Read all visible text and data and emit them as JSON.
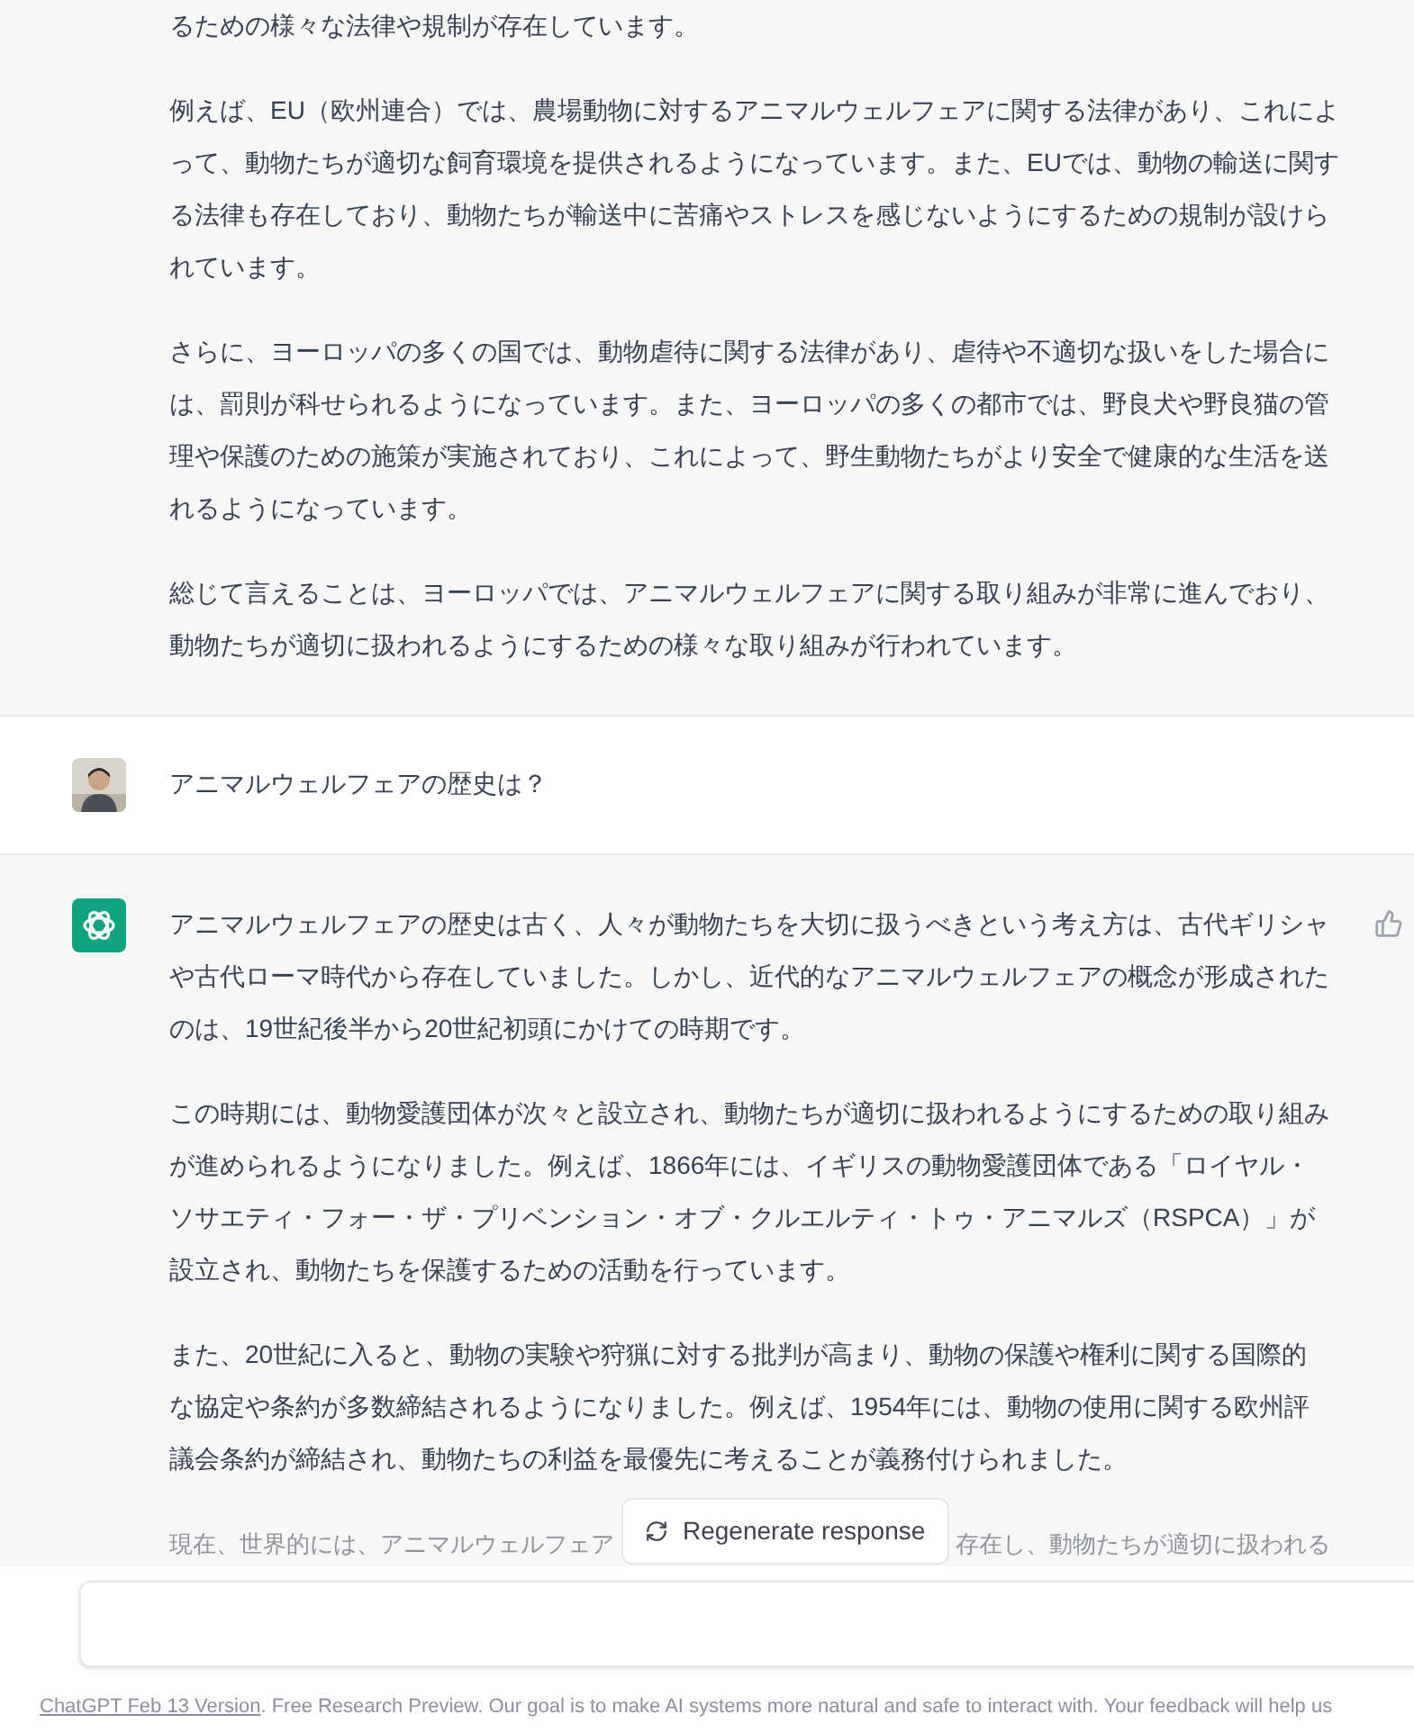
{
  "messages": [
    {
      "kind": "assistant",
      "paragraphs": [
        "るための様々な法律や規制が存在しています。",
        "例えば、EU（欧州連合）では、農場動物に対するアニマルウェルフェアに関する法律があり、これによって、動物たちが適切な飼育環境を提供されるようになっています。また、EUでは、動物の輸送に関する法律も存在しており、動物たちが輸送中に苦痛やストレスを感じないようにするための規制が設けられています。",
        "さらに、ヨーロッパの多くの国では、動物虐待に関する法律があり、虐待や不適切な扱いをした場合には、罰則が科せられるようになっています。また、ヨーロッパの多くの都市では、野良犬や野良猫の管理や保護のための施策が実施されており、これによって、野生動物たちがより安全で健康的な生活を送れるようになっています。",
        "総じて言えることは、ヨーロッパでは、アニマルウェルフェアに関する取り組みが非常に進んでおり、動物たちが適切に扱われるようにするための様々な取り組みが行われています。"
      ]
    },
    {
      "kind": "user",
      "paragraphs": [
        "アニマルウェルフェアの歴史は？"
      ]
    },
    {
      "kind": "assistant",
      "paragraphs": [
        "アニマルウェルフェアの歴史は古く、人々が動物たちを大切に扱うべきという考え方は、古代ギリシャや古代ローマ時代から存在していました。しかし、近代的なアニマルウェルフェアの概念が形成されたのは、19世紀後半から20世紀初頭にかけての時期です。",
        "この時期には、動物愛護団体が次々と設立され、動物たちが適切に扱われるようにするための取り組みが進められるようになりました。例えば、1866年には、イギリスの動物愛護団体である「ロイヤル・ソサエティ・フォー・ザ・プリベンション・オブ・クルエルティ・トゥ・アニマルズ（RSPCA）」が設立され、動物たちを保護するための活動を行っています。",
        "また、20世紀に入ると、動物の実験や狩猟に対する批判が高まり、動物の保護や権利に関する国際的な協定や条約が多数締結されるようになりました。例えば、1954年には、動物の使用に関する欧州評議会条約が締結され、動物たちの利益を最優先に考えることが義務付けられました。"
      ],
      "partly_hidden_paragraph": [
        "現在、世界的には、アニマルウェルフェア",
        "存在し、動物たちが適切に扱われる"
      ]
    }
  ],
  "regenerate_button": "Regenerate response",
  "footer": {
    "link": "ChatGPT Feb 13 Version",
    "text": ". Free Research Preview. Our goal is to make AI systems more natural and safe to interact with. Your feedback will help us"
  }
}
